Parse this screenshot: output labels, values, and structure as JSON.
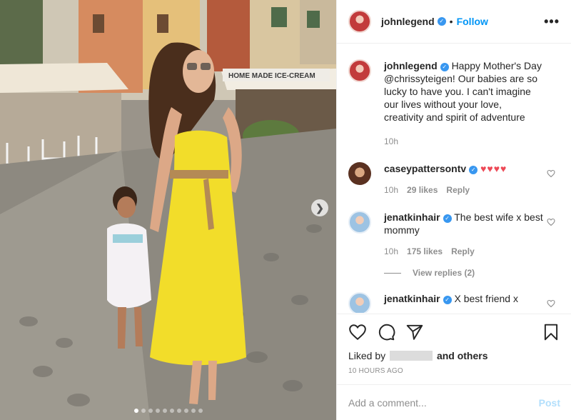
{
  "post": {
    "username": "johnlegend",
    "follow_label": "Follow",
    "separator": "•",
    "more_label": "•••",
    "caption_user": "johnlegend",
    "caption_text": "Happy Mother's Day @chrissyteigen! Our babies are so lucky to have you. I can't imagine our lives without your love, creativity and spirit of adventure",
    "caption_time": "10h",
    "photo_sign": "HOME MADE ICE-CREAM"
  },
  "comments": [
    {
      "user": "caseypattersontv",
      "text": "♥♥♥♥",
      "time": "10h",
      "likes": "29 likes",
      "reply": "Reply"
    },
    {
      "user": "jenatkinhair",
      "text": "The best wife x best mommy",
      "time": "10h",
      "likes": "175 likes",
      "reply": "Reply",
      "view_replies": "View replies (2)"
    },
    {
      "user": "jenatkinhair",
      "text": "X best friend x"
    }
  ],
  "actions": {
    "liked_prefix": "Liked by",
    "liked_suffix": "and others",
    "timestamp": "10 HOURS AGO"
  },
  "add_comment": {
    "placeholder": "Add a comment...",
    "post_label": "Post"
  },
  "carousel": {
    "total": 10,
    "current": 1
  },
  "colors": {
    "accent": "#0095f6",
    "verified": "#3897f0",
    "heart": "#ed4956",
    "post_disabled": "#b2dffc"
  },
  "icons": [
    "heart-icon",
    "comment-icon",
    "share-icon",
    "bookmark-icon",
    "verified-icon",
    "chevron-right-icon",
    "more-icon"
  ]
}
